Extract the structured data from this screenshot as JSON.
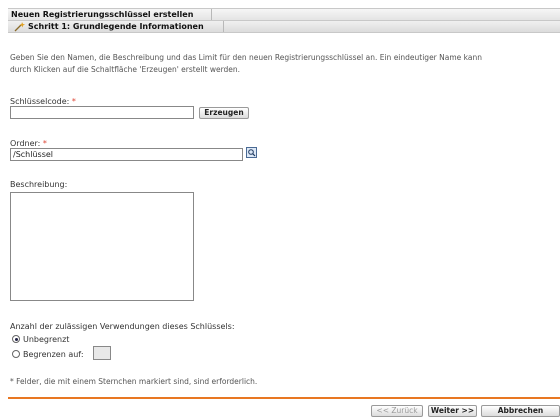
{
  "header": {
    "title": "Neuen Registrierungsschlüssel erstellen",
    "step_title": "Schritt 1: Grundlegende Informationen"
  },
  "intro": {
    "line1": "Geben Sie den Namen, die Beschreibung und das Limit für den neuen Registrierungsschlüssel an. Ein eindeutiger Name kann",
    "line2": "durch Klicken auf die Schaltfläche 'Erzeugen' erstellt werden."
  },
  "form": {
    "key_code": {
      "label": "Schlüsselcode:",
      "required_mark": "*",
      "value": ""
    },
    "generate_button": "Erzeugen",
    "folder": {
      "label": "Ordner:",
      "required_mark": "*",
      "value": "/Schlüssel"
    },
    "description": {
      "label": "Beschreibung:",
      "value": ""
    },
    "usage": {
      "label": "Anzahl der zulässigen Verwendungen dieses Schlüssels:",
      "unlimited": "Unbegrenzt",
      "limit": "Begrenzen auf:",
      "limit_value": "",
      "selected": "unlimited"
    }
  },
  "footnote": "* Felder, die mit einem Sternchen markiert sind, sind erforderlich.",
  "buttons": {
    "back": "<< Zurück",
    "next": "Weiter >>",
    "cancel": "Abbrechen"
  },
  "colors": {
    "accent": "#e87722",
    "required": "#dd4433"
  },
  "icons": {
    "step": "wand-icon",
    "browse": "browse-icon"
  }
}
